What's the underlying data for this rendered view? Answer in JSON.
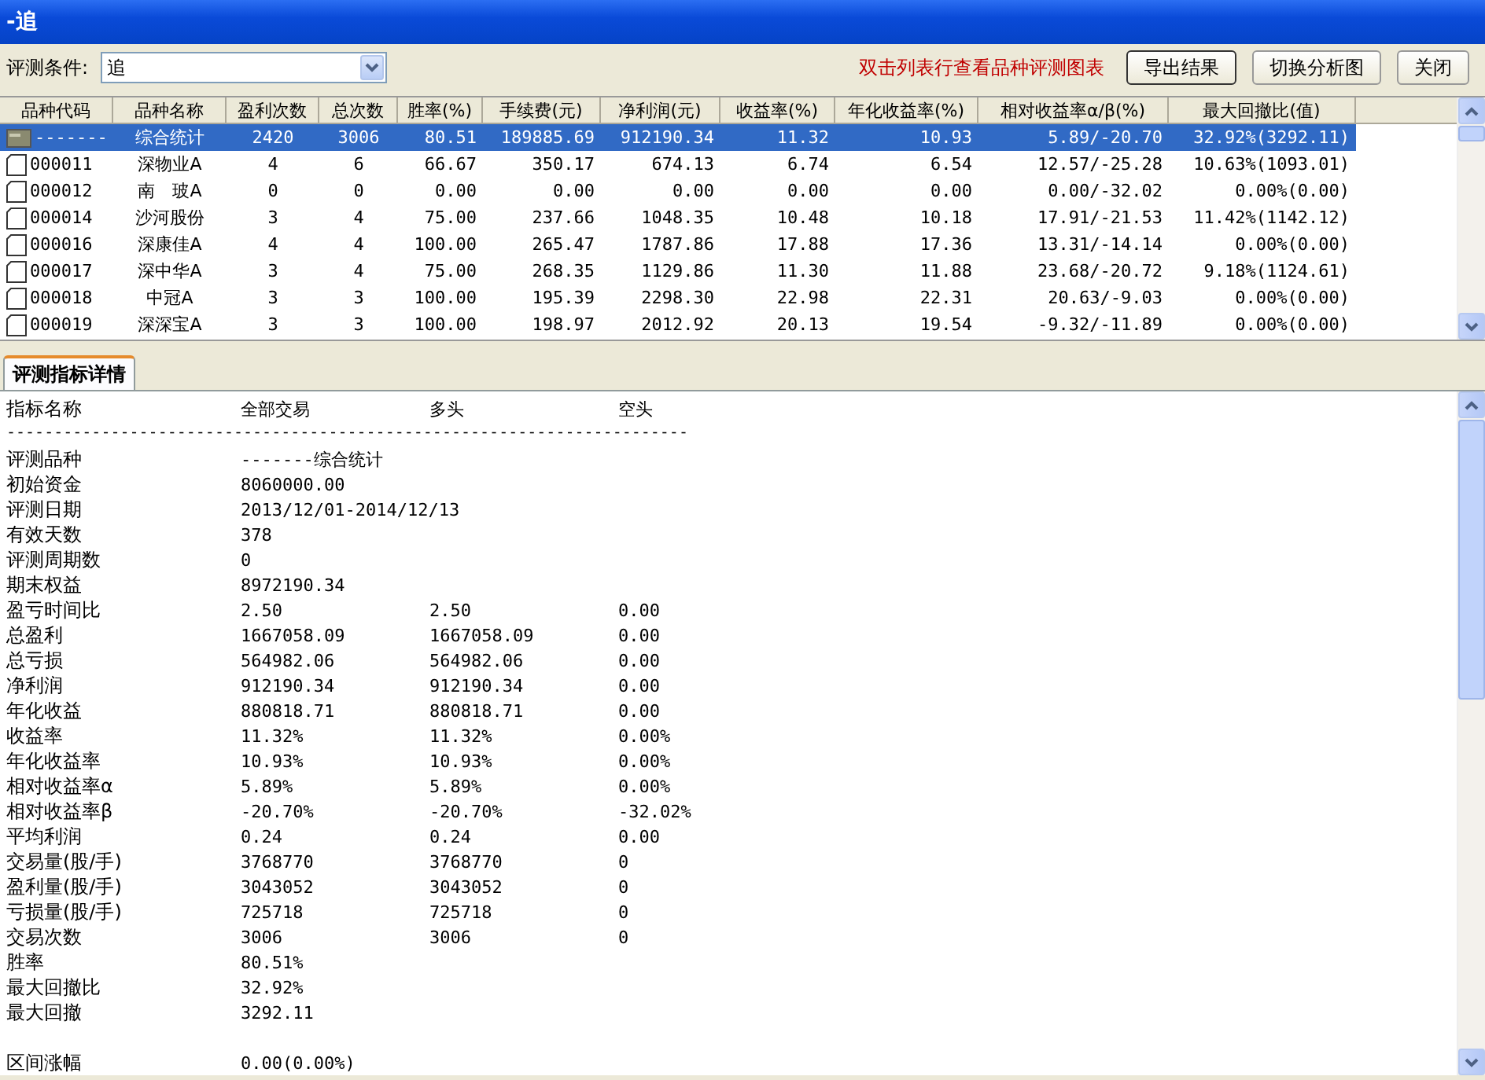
{
  "window": {
    "title": "-追"
  },
  "toolbar": {
    "condition_label": "评测条件:",
    "condition_value": "追",
    "hint": "双击列表行查看品种评测图表",
    "buttons": [
      "导出结果",
      "切换分析图",
      "关闭"
    ]
  },
  "table": {
    "columns": [
      "品种代码",
      "品种名称",
      "盈利次数",
      "总次数",
      "胜率(%)",
      "手续费(元)",
      "净利润(元)",
      "收益率(%)",
      "年化收益率(%)",
      "相对收益率α/β(%)",
      "最大回撤比(值)"
    ],
    "rows": [
      {
        "kind": "summary",
        "selected": true,
        "cells": [
          "-------",
          "综合统计",
          "2420",
          "3006",
          "80.51",
          "189885.69",
          "912190.34",
          "11.32",
          "10.93",
          "5.89/-20.70",
          "32.92%(3292.11)"
        ]
      },
      {
        "kind": "stock",
        "selected": false,
        "cells": [
          "000011",
          "深物业A",
          "4",
          "6",
          "66.67",
          "350.17",
          "674.13",
          "6.74",
          "6.54",
          "12.57/-25.28",
          "10.63%(1093.01)"
        ]
      },
      {
        "kind": "stock",
        "selected": false,
        "cells": [
          "000012",
          "南　玻A",
          "0",
          "0",
          "0.00",
          "0.00",
          "0.00",
          "0.00",
          "0.00",
          "0.00/-32.02",
          "0.00%(0.00)"
        ]
      },
      {
        "kind": "stock",
        "selected": false,
        "cells": [
          "000014",
          "沙河股份",
          "3",
          "4",
          "75.00",
          "237.66",
          "1048.35",
          "10.48",
          "10.18",
          "17.91/-21.53",
          "11.42%(1142.12)"
        ]
      },
      {
        "kind": "stock",
        "selected": false,
        "cells": [
          "000016",
          "深康佳A",
          "4",
          "4",
          "100.00",
          "265.47",
          "1787.86",
          "17.88",
          "17.36",
          "13.31/-14.14",
          "0.00%(0.00)"
        ]
      },
      {
        "kind": "stock",
        "selected": false,
        "cells": [
          "000017",
          "深中华A",
          "3",
          "4",
          "75.00",
          "268.35",
          "1129.86",
          "11.30",
          "11.88",
          "23.68/-20.72",
          "9.18%(1124.61)"
        ]
      },
      {
        "kind": "stock",
        "selected": false,
        "cells": [
          "000018",
          "中冠A",
          "3",
          "3",
          "100.00",
          "195.39",
          "2298.30",
          "22.98",
          "22.31",
          "20.63/-9.03",
          "0.00%(0.00)"
        ]
      },
      {
        "kind": "stock",
        "selected": false,
        "cells": [
          "000019",
          "深深宝A",
          "3",
          "3",
          "100.00",
          "198.97",
          "2012.92",
          "20.13",
          "19.54",
          "-9.32/-11.89",
          "0.00%(0.00)"
        ]
      }
    ]
  },
  "details_tab": {
    "label": "评测指标详情",
    "selected": true
  },
  "details": {
    "header": [
      "指标名称",
      "全部交易",
      "多头",
      "空头"
    ],
    "divider": "------------------------------------------------------------------------",
    "rows": [
      {
        "cells": [
          "评测品种",
          "-------综合统计"
        ]
      },
      {
        "cells": [
          "初始资金",
          "8060000.00"
        ]
      },
      {
        "cells": [
          "评测日期",
          "2013/12/01-2014/12/13"
        ]
      },
      {
        "cells": [
          "有效天数",
          "378"
        ]
      },
      {
        "cells": [
          "评测周期数",
          "0"
        ]
      },
      {
        "cells": [
          "期末权益",
          "8972190.34"
        ]
      },
      {
        "cells": [
          "盈亏时间比",
          "2.50",
          "2.50",
          "0.00"
        ]
      },
      {
        "cells": [
          "总盈利",
          "1667058.09",
          "1667058.09",
          "0.00"
        ]
      },
      {
        "cells": [
          "总亏损",
          "564982.06",
          "564982.06",
          "0.00"
        ]
      },
      {
        "cells": [
          "净利润",
          "912190.34",
          "912190.34",
          "0.00"
        ]
      },
      {
        "cells": [
          "年化收益",
          "880818.71",
          "880818.71",
          "0.00"
        ]
      },
      {
        "cells": [
          "收益率",
          "11.32%",
          "11.32%",
          "0.00%"
        ]
      },
      {
        "cells": [
          "年化收益率",
          "10.93%",
          "10.93%",
          "0.00%"
        ]
      },
      {
        "cells": [
          "相对收益率α",
          "5.89%",
          "5.89%",
          "0.00%"
        ]
      },
      {
        "cells": [
          "相对收益率β",
          "-20.70%",
          "-20.70%",
          "-32.02%"
        ]
      },
      {
        "cells": [
          "平均利润",
          "0.24",
          "0.24",
          "0.00"
        ]
      },
      {
        "cells": [
          "交易量(股/手)",
          "3768770",
          "3768770",
          "0"
        ]
      },
      {
        "cells": [
          "盈利量(股/手)",
          "3043052",
          "3043052",
          "0"
        ]
      },
      {
        "cells": [
          "亏损量(股/手)",
          "725718",
          "725718",
          "0"
        ]
      },
      {
        "cells": [
          "交易次数",
          "3006",
          "3006",
          "0"
        ]
      },
      {
        "cells": [
          "胜率",
          "80.51%"
        ]
      },
      {
        "cells": [
          "最大回撤比",
          "32.92%"
        ]
      },
      {
        "cells": [
          "最大回撤",
          "3292.11"
        ]
      },
      {
        "cells": [
          "区间涨幅",
          "0.00(0.00%)"
        ],
        "gap_before": true
      }
    ]
  }
}
